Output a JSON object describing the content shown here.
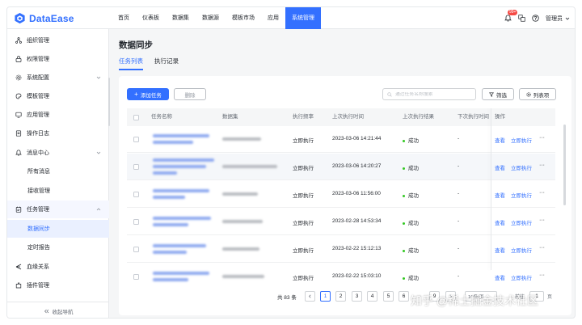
{
  "app": {
    "brand": "DataEase"
  },
  "topnav": {
    "items": [
      {
        "label": "首页"
      },
      {
        "label": "仪表板"
      },
      {
        "label": "数据集"
      },
      {
        "label": "数据源"
      },
      {
        "label": "模板市场"
      },
      {
        "label": "应用"
      },
      {
        "label": "系统管理",
        "active": true
      }
    ],
    "notify_badge": "99+",
    "user_label": "管理员"
  },
  "sidebar": {
    "items": [
      {
        "label": "组织管理",
        "icon": "org-icon"
      },
      {
        "label": "权限管理",
        "icon": "lock-icon"
      },
      {
        "label": "系统配置",
        "icon": "gear-icon"
      },
      {
        "label": "模板管理",
        "icon": "template-icon"
      },
      {
        "label": "应用管理",
        "icon": "app-icon"
      },
      {
        "label": "操作日志",
        "icon": "log-icon"
      },
      {
        "label": "消息中心",
        "icon": "bell-icon"
      },
      {
        "label": "所有消息"
      },
      {
        "label": "接收管理"
      },
      {
        "label": "任务管理",
        "icon": "task-icon"
      },
      {
        "label": "数据同步"
      },
      {
        "label": "定时报告"
      },
      {
        "label": "血缘关系",
        "icon": "lineage-icon"
      },
      {
        "label": "插件管理",
        "icon": "plugin-icon"
      }
    ],
    "footer": "收起导航"
  },
  "page": {
    "title": "数据同步",
    "tabs": [
      {
        "label": "任务列表",
        "active": true
      },
      {
        "label": "执行记录"
      }
    ]
  },
  "toolbar": {
    "add_label": "添加任务",
    "delete_label": "删除",
    "search_placeholder": "通过任务名称搜索",
    "filter_label": "筛选",
    "columns_label": "列表项"
  },
  "table": {
    "headers": [
      "任务名称",
      "数据集",
      "执行频率",
      "上次执行时间",
      "上次执行结果",
      "下次执行时间",
      "操作"
    ],
    "rows": [
      {
        "freq": "立即执行",
        "last_time": "2023-03-06 14:21:44",
        "result": "成功",
        "next": "-"
      },
      {
        "freq": "立即执行",
        "last_time": "2023-03-06 14:20:27",
        "result": "成功",
        "next": "-"
      },
      {
        "freq": "立即执行",
        "last_time": "2023-03-06 11:56:00",
        "result": "成功",
        "next": "-"
      },
      {
        "freq": "立即执行",
        "last_time": "2023-02-28 14:53:34",
        "result": "成功",
        "next": "-"
      },
      {
        "freq": "立即执行",
        "last_time": "2023-02-22 15:12:13",
        "result": "成功",
        "next": "-"
      },
      {
        "freq": "立即执行",
        "last_time": "2023-02-22 15:03:10",
        "result": "成功",
        "next": "-"
      }
    ],
    "action_view": "查看",
    "action_run": "立即执行",
    "action_more": "···"
  },
  "pagination": {
    "total": "共 83 条",
    "pages": [
      "1",
      "2",
      "3",
      "4",
      "5",
      "6"
    ],
    "ellipsis": "···",
    "last": "9",
    "size": "10条/页",
    "goto": "前往",
    "goto_value": "1",
    "page_unit": "页"
  },
  "watermark": "知乎 @稀土掘金技术社区"
}
